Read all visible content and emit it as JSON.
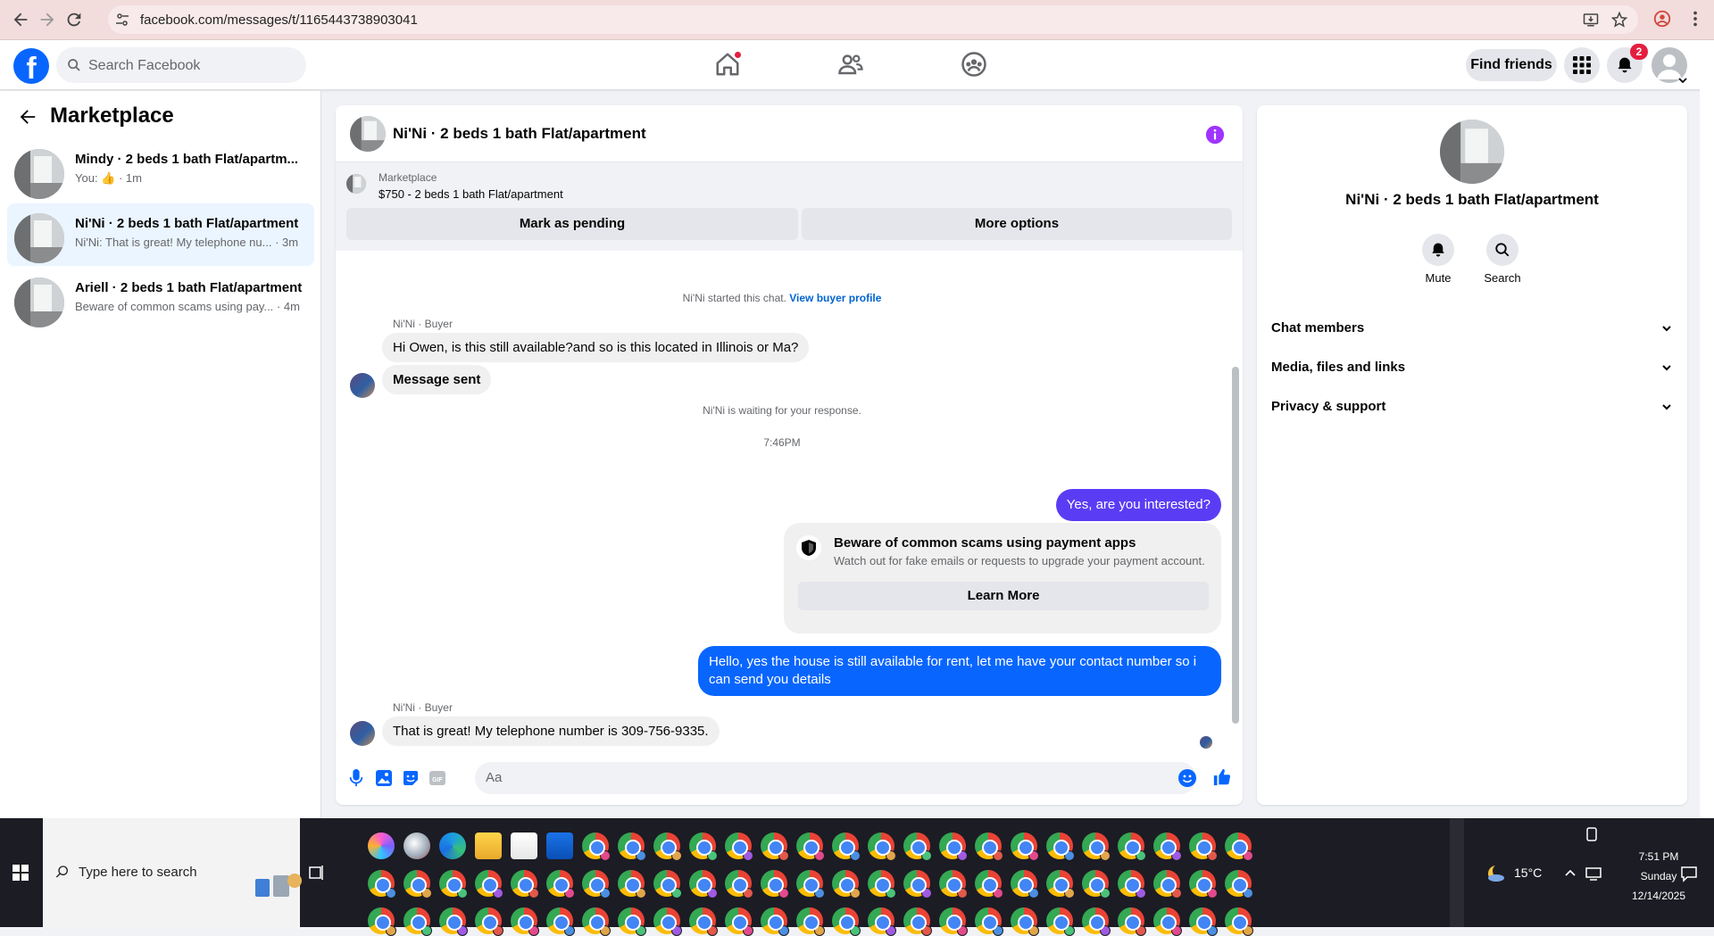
{
  "browser": {
    "url": "facebook.com/messages/t/1165443738903041"
  },
  "fb": {
    "search_placeholder": "Search Facebook",
    "find_friends": "Find friends",
    "notif_count": "2"
  },
  "sidebar": {
    "title": "Marketplace",
    "conversations": [
      {
        "title": "Mindy · 2 beds 1 bath Flat/apartm...",
        "preview": "You: 👍 · 1m"
      },
      {
        "title": "Ni'Ni · 2 beds 1 bath Flat/apartment",
        "preview": "Ni'Ni: That is great! My telephone nu... · 3m"
      },
      {
        "title": "Ariell · 2 beds 1 bath Flat/apartment",
        "preview": "Beware of common scams using pay... · 4m"
      }
    ]
  },
  "chat": {
    "title": "Ni'Ni · 2 beds 1 bath Flat/apartment",
    "listing_source": "Marketplace",
    "listing_price": "$750 - 2 beds 1 bath Flat/apartment",
    "mark_pending": "Mark as pending",
    "more_options": "More options",
    "started_text": "Ni'Ni started this chat.",
    "view_buyer_profile": "View buyer profile",
    "sender_label": "Ni'Ni · Buyer",
    "msg1": "Hi Owen, is this still available?and so is this  located in Illinois or Ma?",
    "msg2": "Message sent",
    "waiting": "Ni'Ni is waiting for your response.",
    "time": "7:46PM",
    "out1": "Yes, are you interested?",
    "scam_title": "Beware of common scams using payment apps",
    "scam_desc": "Watch out for fake emails or requests to upgrade your payment account.",
    "learn_more": "Learn More",
    "out2": "Hello, yes the house is still available for rent, let me have your contact number so i can send you details",
    "sender_label2": "Ni'Ni · Buyer",
    "msg3": "That is great! My telephone number is 309-756-9335.",
    "input_placeholder": "Aa"
  },
  "details": {
    "name": "Ni'Ni · 2 beds 1 bath Flat/apartment",
    "mute": "Mute",
    "search": "Search",
    "sections": [
      "Chat members",
      "Media, files and links",
      "Privacy & support"
    ]
  },
  "taskbar": {
    "search_placeholder": "Type here to search",
    "temperature": "15°C",
    "time": "7:51 PM",
    "day": "Sunday",
    "date": "12/14/2025"
  },
  "colors": {
    "fb_blue": "#0866ff",
    "outgoing_purple": "#5b3cf5",
    "info_purple": "#a033ff"
  }
}
